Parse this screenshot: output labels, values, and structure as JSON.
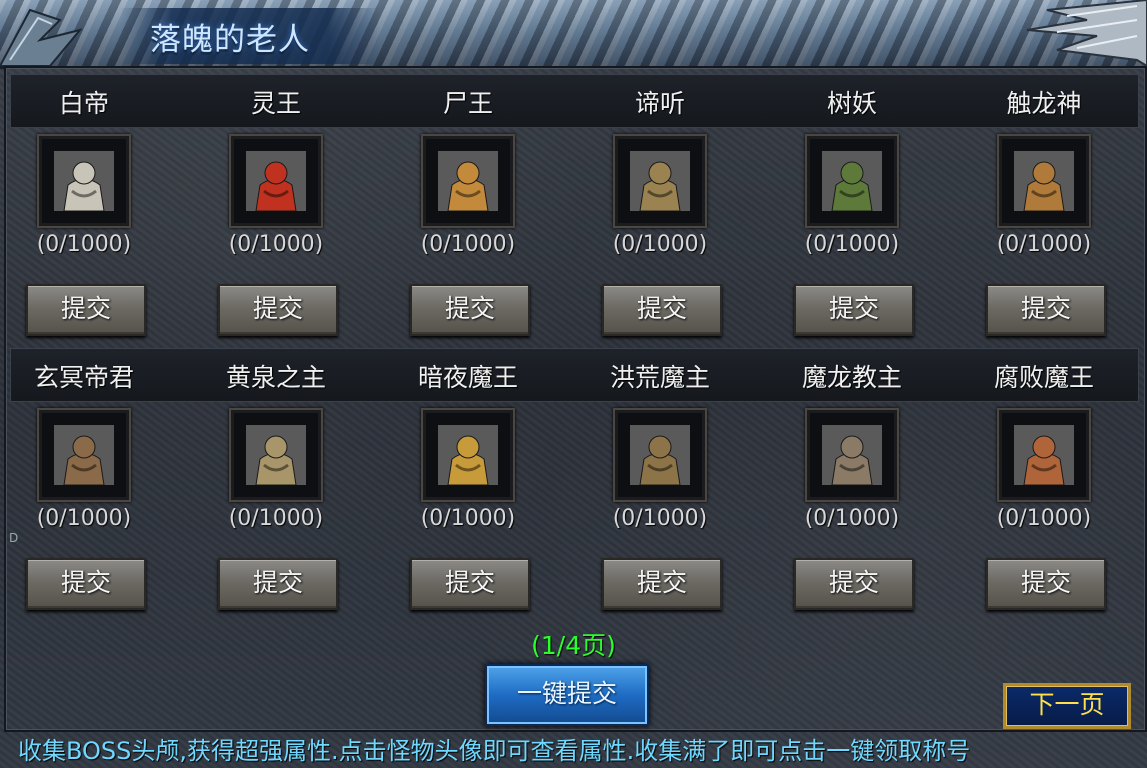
{
  "title": "落魄的老人",
  "rows": [
    {
      "bosses": [
        {
          "name": "白帝",
          "count": "(0/1000)",
          "submit_label": "提交",
          "portrait": "white-armored-boss-icon",
          "color": "#c9c4b8"
        },
        {
          "name": "灵王",
          "count": "(0/1000)",
          "submit_label": "提交",
          "portrait": "red-spirit-king-icon",
          "color": "#c0321f"
        },
        {
          "name": "尸王",
          "count": "(0/1000)",
          "submit_label": "提交",
          "portrait": "corpse-king-icon",
          "color": "#c48a3c"
        },
        {
          "name": "谛听",
          "count": "(0/1000)",
          "submit_label": "提交",
          "portrait": "diting-beast-icon",
          "color": "#9a8350"
        },
        {
          "name": "树妖",
          "count": "(0/1000)",
          "submit_label": "提交",
          "portrait": "tree-demon-icon",
          "color": "#5e7a3a"
        },
        {
          "name": "触龙神",
          "count": "(0/1000)",
          "submit_label": "提交",
          "portrait": "centipede-god-icon",
          "color": "#b07a3a"
        }
      ]
    },
    {
      "bosses": [
        {
          "name": "玄冥帝君",
          "count": "(0/1000)",
          "submit_label": "提交",
          "portrait": "xuanming-emperor-icon",
          "color": "#8a6a48"
        },
        {
          "name": "黄泉之主",
          "count": "(0/1000)",
          "submit_label": "提交",
          "portrait": "underworld-lord-icon",
          "color": "#a8966a"
        },
        {
          "name": "暗夜魔王",
          "count": "(0/1000)",
          "submit_label": "提交",
          "portrait": "night-demon-king-icon",
          "color": "#c79a3a"
        },
        {
          "name": "洪荒魔主",
          "count": "(0/1000)",
          "submit_label": "提交",
          "portrait": "primal-demon-lord-icon",
          "color": "#8c7448"
        },
        {
          "name": "魔龙教主",
          "count": "(0/1000)",
          "submit_label": "提交",
          "portrait": "demon-dragon-master-icon",
          "color": "#8a7a66"
        },
        {
          "name": "腐败魔王",
          "count": "(0/1000)",
          "submit_label": "提交",
          "portrait": "rotten-demon-king-icon",
          "color": "#b0643a"
        }
      ]
    }
  ],
  "page_indicator": "(1/4页)",
  "submit_all_label": "一键提交",
  "next_page_label": "下一页",
  "footer_text": "收集BOSS头颅,获得超强属性.点击怪物头像即可查看属性.收集满了即可点击一键领取称号",
  "side_mark": "D"
}
